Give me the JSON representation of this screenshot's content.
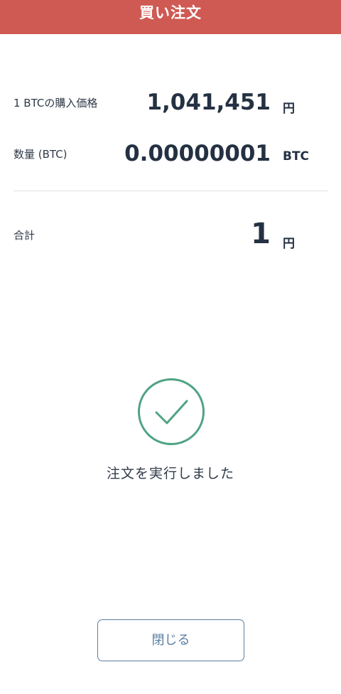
{
  "header": {
    "title": "買い注文"
  },
  "order": {
    "price": {
      "label": "1 BTCの購入価格",
      "value": "1,041,451",
      "unit": "円"
    },
    "quantity": {
      "label": "数量 (BTC)",
      "value": "0.00000001",
      "unit": "BTC"
    },
    "total": {
      "label": "合計",
      "value": "1",
      "unit": "円"
    }
  },
  "status": {
    "icon": "checkmark-circle-icon",
    "message": "注文を実行しました",
    "color": "#4fa383"
  },
  "actions": {
    "close_label": "閉じる"
  },
  "colors": {
    "header": "#cf5a53",
    "button_border": "#5a7fa0"
  }
}
